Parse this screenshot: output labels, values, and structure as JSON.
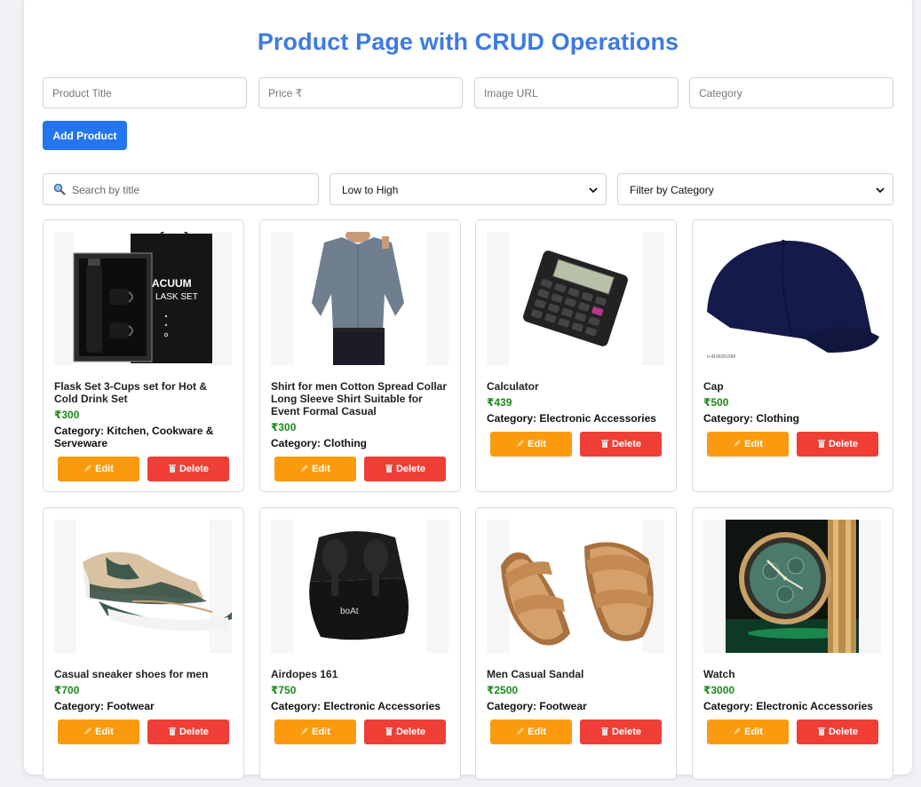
{
  "page": {
    "title": "Product Page with CRUD Operations"
  },
  "form": {
    "title_placeholder": "Product Title",
    "price_placeholder": "Price ₹",
    "image_placeholder": "Image URL",
    "category_placeholder": "Category",
    "add_button": "Add Product"
  },
  "toolbar": {
    "search_placeholder": "Search by title",
    "search_icon": "magnifier-icon",
    "sort_value": "Low to High",
    "category_filter_value": "Filter by Category"
  },
  "card_labels": {
    "category_prefix": "Category:",
    "edit": "Edit",
    "delete": "Delete",
    "edit_icon": "pencil-icon",
    "delete_icon": "trash-icon"
  },
  "products": [
    {
      "title": "Flask Set 3-Cups set for Hot & Cold Drink Set",
      "price": "₹300",
      "category": "Kitchen, Cookware & Serveware",
      "image": "flask-set-image"
    },
    {
      "title": "Shirt for men Cotton Spread Collar Long Sleeve Shirt Suitable for Event Formal Casual",
      "price": "₹300",
      "category": "Clothing",
      "image": "shirt-image"
    },
    {
      "title": "Calculator",
      "price": "₹439",
      "category": "Electronic Accessories",
      "image": "calculator-image"
    },
    {
      "title": "Cap",
      "price": "₹500",
      "category": "Clothing",
      "image": "cap-image"
    },
    {
      "title": "Casual sneaker shoes for men",
      "price": "₹700",
      "category": "Footwear",
      "image": "sneaker-image"
    },
    {
      "title": "Airdopes 161",
      "price": "₹750",
      "category": "Electronic Accessories",
      "image": "earbuds-image"
    },
    {
      "title": "Men Casual Sandal",
      "price": "₹2500",
      "category": "Footwear",
      "image": "sandal-image"
    },
    {
      "title": "Watch",
      "price": "₹3000",
      "category": "Electronic Accessories",
      "image": "watch-image"
    }
  ],
  "image_text": {
    "flask_box": "ACUUM\nLASK SET",
    "earbuds_brand": "boAt",
    "cap_code": "n-416605158#"
  },
  "colors": {
    "accent": "#2575ee",
    "title": "#3d7be0",
    "price": "#1a8a1a",
    "edit": "#fb9a0d",
    "delete": "#ef3e35"
  }
}
